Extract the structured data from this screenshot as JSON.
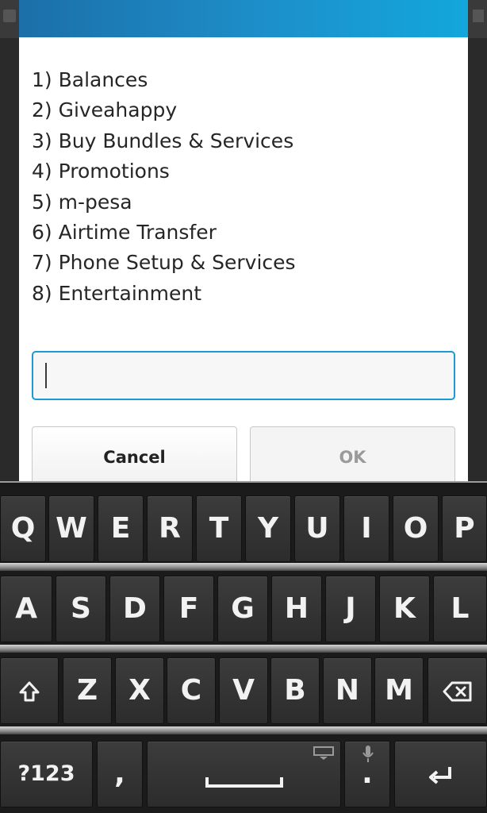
{
  "dialog": {
    "menu_items": [
      "1) Balances",
      "2) Giveahappy",
      "3) Buy Bundles & Services",
      "4) Promotions",
      "5) m-pesa",
      "6) Airtime Transfer",
      "7) Phone Setup & Services",
      "8) Entertainment"
    ],
    "input_value": "",
    "cancel_label": "Cancel",
    "ok_label": "OK"
  },
  "keyboard": {
    "row1": [
      "Q",
      "W",
      "E",
      "R",
      "T",
      "Y",
      "U",
      "I",
      "O",
      "P"
    ],
    "row2": [
      "A",
      "S",
      "D",
      "F",
      "G",
      "H",
      "J",
      "K",
      "L"
    ],
    "row3": [
      "Z",
      "X",
      "C",
      "V",
      "B",
      "N",
      "M"
    ],
    "numbers_label": "?123",
    "comma_label": ",",
    "period_label": "."
  },
  "colors": {
    "header_accent": "#1d8fca",
    "input_border": "#1b9ad3",
    "key_bg": "#333333"
  },
  "icons": {
    "shift": "shift-icon",
    "backspace": "backspace-icon",
    "space": "space-icon",
    "enter": "enter-icon",
    "keyboard_hide": "keyboard-icon",
    "mic": "microphone-icon"
  }
}
